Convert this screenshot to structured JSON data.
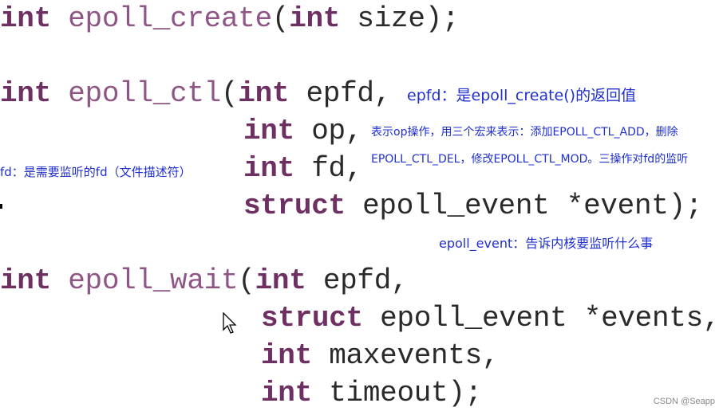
{
  "code_lines": [
    {
      "tokens": [
        {
          "t": "int",
          "c": "kw"
        },
        {
          "t": " "
        },
        {
          "t": "epoll_create",
          "c": "fn"
        },
        {
          "t": "("
        },
        {
          "t": "int",
          "c": "kw"
        },
        {
          "t": " size);"
        }
      ]
    },
    {
      "tokens": [
        {
          "t": "int",
          "c": "kw"
        },
        {
          "t": " "
        },
        {
          "t": "epoll_ctl",
          "c": "fn"
        },
        {
          "t": "("
        },
        {
          "t": "int",
          "c": "kw"
        },
        {
          "t": " epfd,"
        }
      ]
    },
    {
      "tokens": [
        {
          "t": "int",
          "c": "kw"
        },
        {
          "t": " op,"
        }
      ]
    },
    {
      "tokens": [
        {
          "t": "int",
          "c": "kw"
        },
        {
          "t": " fd,"
        }
      ]
    },
    {
      "tokens": [
        {
          "t": "struct",
          "c": "kw"
        },
        {
          "t": " epoll_event *event);"
        }
      ]
    },
    {
      "tokens": [
        {
          "t": "int",
          "c": "kw"
        },
        {
          "t": " "
        },
        {
          "t": "epoll_wait",
          "c": "fn"
        },
        {
          "t": "("
        },
        {
          "t": "int",
          "c": "kw"
        },
        {
          "t": " epfd,"
        }
      ]
    },
    {
      "tokens": [
        {
          "t": "struct",
          "c": "kw"
        },
        {
          "t": " epoll_event *events,"
        }
      ]
    },
    {
      "tokens": [
        {
          "t": "int",
          "c": "kw"
        },
        {
          "t": " maxevents,"
        }
      ]
    },
    {
      "tokens": [
        {
          "t": "int",
          "c": "kw"
        },
        {
          "t": " timeout);"
        }
      ]
    }
  ],
  "notes": {
    "epfd": "epfd：是epoll_create()的返回值",
    "op_line1": "表示op操作，用三个宏来表示：添加EPOLL_CTL_ADD，删除",
    "op_line2": "EPOLL_CTL_DEL，修改EPOLL_CTL_MOD。三操作对fd的监听",
    "fd": "fd：是需要监听的fd（文件描述符）",
    "event": "epoll_event：告诉内核要监听什么事"
  },
  "watermark": "CSDN @Seapp",
  "colors": {
    "annotation": "#1f2fd0",
    "keyword": "#6e2f62",
    "function": "#8e5585"
  }
}
